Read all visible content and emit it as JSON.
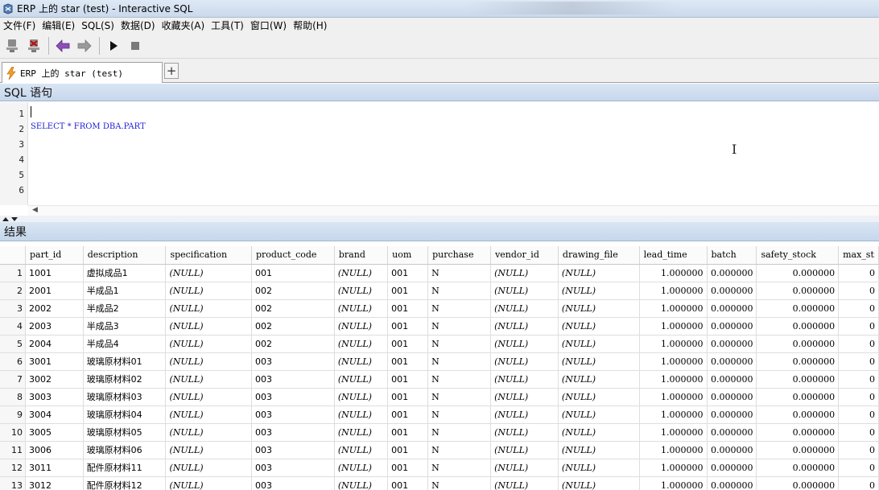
{
  "window": {
    "title": "ERP 上的 star (test) - Interactive SQL"
  },
  "menu": [
    "文件(F)",
    "编辑(E)",
    "SQL(S)",
    "数据(D)",
    "收藏夹(A)",
    "工具(T)",
    "窗口(W)",
    "帮助(H)"
  ],
  "toolbar": {
    "icons": [
      "connect-icon",
      "disconnect-icon",
      "back-icon",
      "forward-icon",
      "execute-icon",
      "stop-icon"
    ]
  },
  "tab": {
    "label": "ERP 上的 star (test)",
    "add": "+"
  },
  "sql_panel": {
    "title": "SQL 语句"
  },
  "editor": {
    "line_numbers": [
      "1",
      "2",
      "3",
      "4",
      "5",
      "6"
    ],
    "lines": [
      "",
      "SELECT * FROM DBA.PART",
      "",
      "",
      "",
      ""
    ]
  },
  "results_panel": {
    "title": "结果"
  },
  "grid": {
    "columns": [
      "part_id",
      "description",
      "specification",
      "product_code",
      "brand",
      "uom",
      "purchase",
      "vendor_id",
      "drawing_file",
      "lead_time",
      "batch",
      "safety_stock",
      "max_st"
    ],
    "rows": [
      [
        "1",
        "1001",
        "虚拟成品1",
        "(NULL)",
        "001",
        "(NULL)",
        "001",
        "N",
        "(NULL)",
        "(NULL)",
        "1.000000",
        "0.000000",
        "0.000000",
        "0"
      ],
      [
        "2",
        "2001",
        "半成品1",
        "(NULL)",
        "002",
        "(NULL)",
        "001",
        "N",
        "(NULL)",
        "(NULL)",
        "1.000000",
        "0.000000",
        "0.000000",
        "0"
      ],
      [
        "3",
        "2002",
        "半成品2",
        "(NULL)",
        "002",
        "(NULL)",
        "001",
        "N",
        "(NULL)",
        "(NULL)",
        "1.000000",
        "0.000000",
        "0.000000",
        "0"
      ],
      [
        "4",
        "2003",
        "半成品3",
        "(NULL)",
        "002",
        "(NULL)",
        "001",
        "N",
        "(NULL)",
        "(NULL)",
        "1.000000",
        "0.000000",
        "0.000000",
        "0"
      ],
      [
        "5",
        "2004",
        "半成品4",
        "(NULL)",
        "002",
        "(NULL)",
        "001",
        "N",
        "(NULL)",
        "(NULL)",
        "1.000000",
        "0.000000",
        "0.000000",
        "0"
      ],
      [
        "6",
        "3001",
        "玻璃原材料01",
        "(NULL)",
        "003",
        "(NULL)",
        "001",
        "N",
        "(NULL)",
        "(NULL)",
        "1.000000",
        "0.000000",
        "0.000000",
        "0"
      ],
      [
        "7",
        "3002",
        "玻璃原材料02",
        "(NULL)",
        "003",
        "(NULL)",
        "001",
        "N",
        "(NULL)",
        "(NULL)",
        "1.000000",
        "0.000000",
        "0.000000",
        "0"
      ],
      [
        "8",
        "3003",
        "玻璃原材料03",
        "(NULL)",
        "003",
        "(NULL)",
        "001",
        "N",
        "(NULL)",
        "(NULL)",
        "1.000000",
        "0.000000",
        "0.000000",
        "0"
      ],
      [
        "9",
        "3004",
        "玻璃原材料04",
        "(NULL)",
        "003",
        "(NULL)",
        "001",
        "N",
        "(NULL)",
        "(NULL)",
        "1.000000",
        "0.000000",
        "0.000000",
        "0"
      ],
      [
        "10",
        "3005",
        "玻璃原材料05",
        "(NULL)",
        "003",
        "(NULL)",
        "001",
        "N",
        "(NULL)",
        "(NULL)",
        "1.000000",
        "0.000000",
        "0.000000",
        "0"
      ],
      [
        "11",
        "3006",
        "玻璃原材料06",
        "(NULL)",
        "003",
        "(NULL)",
        "001",
        "N",
        "(NULL)",
        "(NULL)",
        "1.000000",
        "0.000000",
        "0.000000",
        "0"
      ],
      [
        "12",
        "3011",
        "配件原材料11",
        "(NULL)",
        "003",
        "(NULL)",
        "001",
        "N",
        "(NULL)",
        "(NULL)",
        "1.000000",
        "0.000000",
        "0.000000",
        "0"
      ],
      [
        "13",
        "3012",
        "配件原材料12",
        "(NULL)",
        "003",
        "(NULL)",
        "001",
        "N",
        "(NULL)",
        "(NULL)",
        "1.000000",
        "0.000000",
        "0.000000",
        "0"
      ]
    ]
  }
}
